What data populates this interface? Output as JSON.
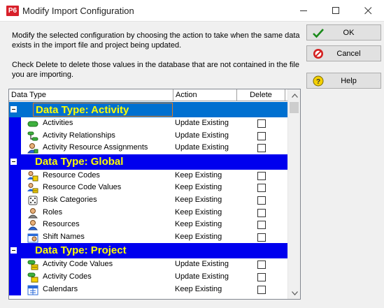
{
  "window": {
    "app_icon_text": "P6",
    "title": "Modify Import Configuration"
  },
  "instructions": {
    "para1": "Modify the selected configuration by choosing the action to take when the same data exists in the import file and project being updated.",
    "para2": "Check Delete to delete those values in the database that are not contained in the file you are importing."
  },
  "buttons": {
    "ok": "OK",
    "cancel": "Cancel",
    "help": "Help"
  },
  "grid": {
    "headers": {
      "data_type": "Data Type",
      "action": "Action",
      "delete": "Delete"
    },
    "groups": [
      {
        "title": "Data Type: Activity",
        "rows": [
          {
            "label": "Activities",
            "action": "Update Existing",
            "icon": "activity-bar-icon",
            "delete": false
          },
          {
            "label": "Activity Relationships",
            "action": "Update Existing",
            "icon": "relationship-icon",
            "delete": false
          },
          {
            "label": "Activity Resource Assignments",
            "action": "Update Existing",
            "icon": "resource-assignment-icon",
            "delete": false
          }
        ]
      },
      {
        "title": "Data Type: Global",
        "rows": [
          {
            "label": "Resource Codes",
            "action": "Keep Existing",
            "icon": "resource-code-icon",
            "delete": false
          },
          {
            "label": "Resource Code Values",
            "action": "Keep Existing",
            "icon": "resource-code-values-icon",
            "delete": false
          },
          {
            "label": "Risk Categories",
            "action": "Keep Existing",
            "icon": "dice-icon",
            "delete": false
          },
          {
            "label": "Roles",
            "action": "Keep Existing",
            "icon": "role-person-icon",
            "delete": false
          },
          {
            "label": "Resources",
            "action": "Keep Existing",
            "icon": "resource-person-icon",
            "delete": false
          },
          {
            "label": "Shift Names",
            "action": "Keep Existing",
            "icon": "shift-icon",
            "delete": false
          }
        ]
      },
      {
        "title": "Data Type: Project",
        "rows": [
          {
            "label": "Activity Code Values",
            "action": "Update Existing",
            "icon": "activity-code-values-icon",
            "delete": false
          },
          {
            "label": "Activity Codes",
            "action": "Update Existing",
            "icon": "activity-code-icon",
            "delete": false
          },
          {
            "label": "Calendars",
            "action": "Keep Existing",
            "icon": "calendar-icon",
            "delete": false
          }
        ]
      }
    ]
  },
  "colors": {
    "group_band": "#0000ee",
    "group_band_selected": "#0070d0",
    "group_title": "#ffff00"
  }
}
